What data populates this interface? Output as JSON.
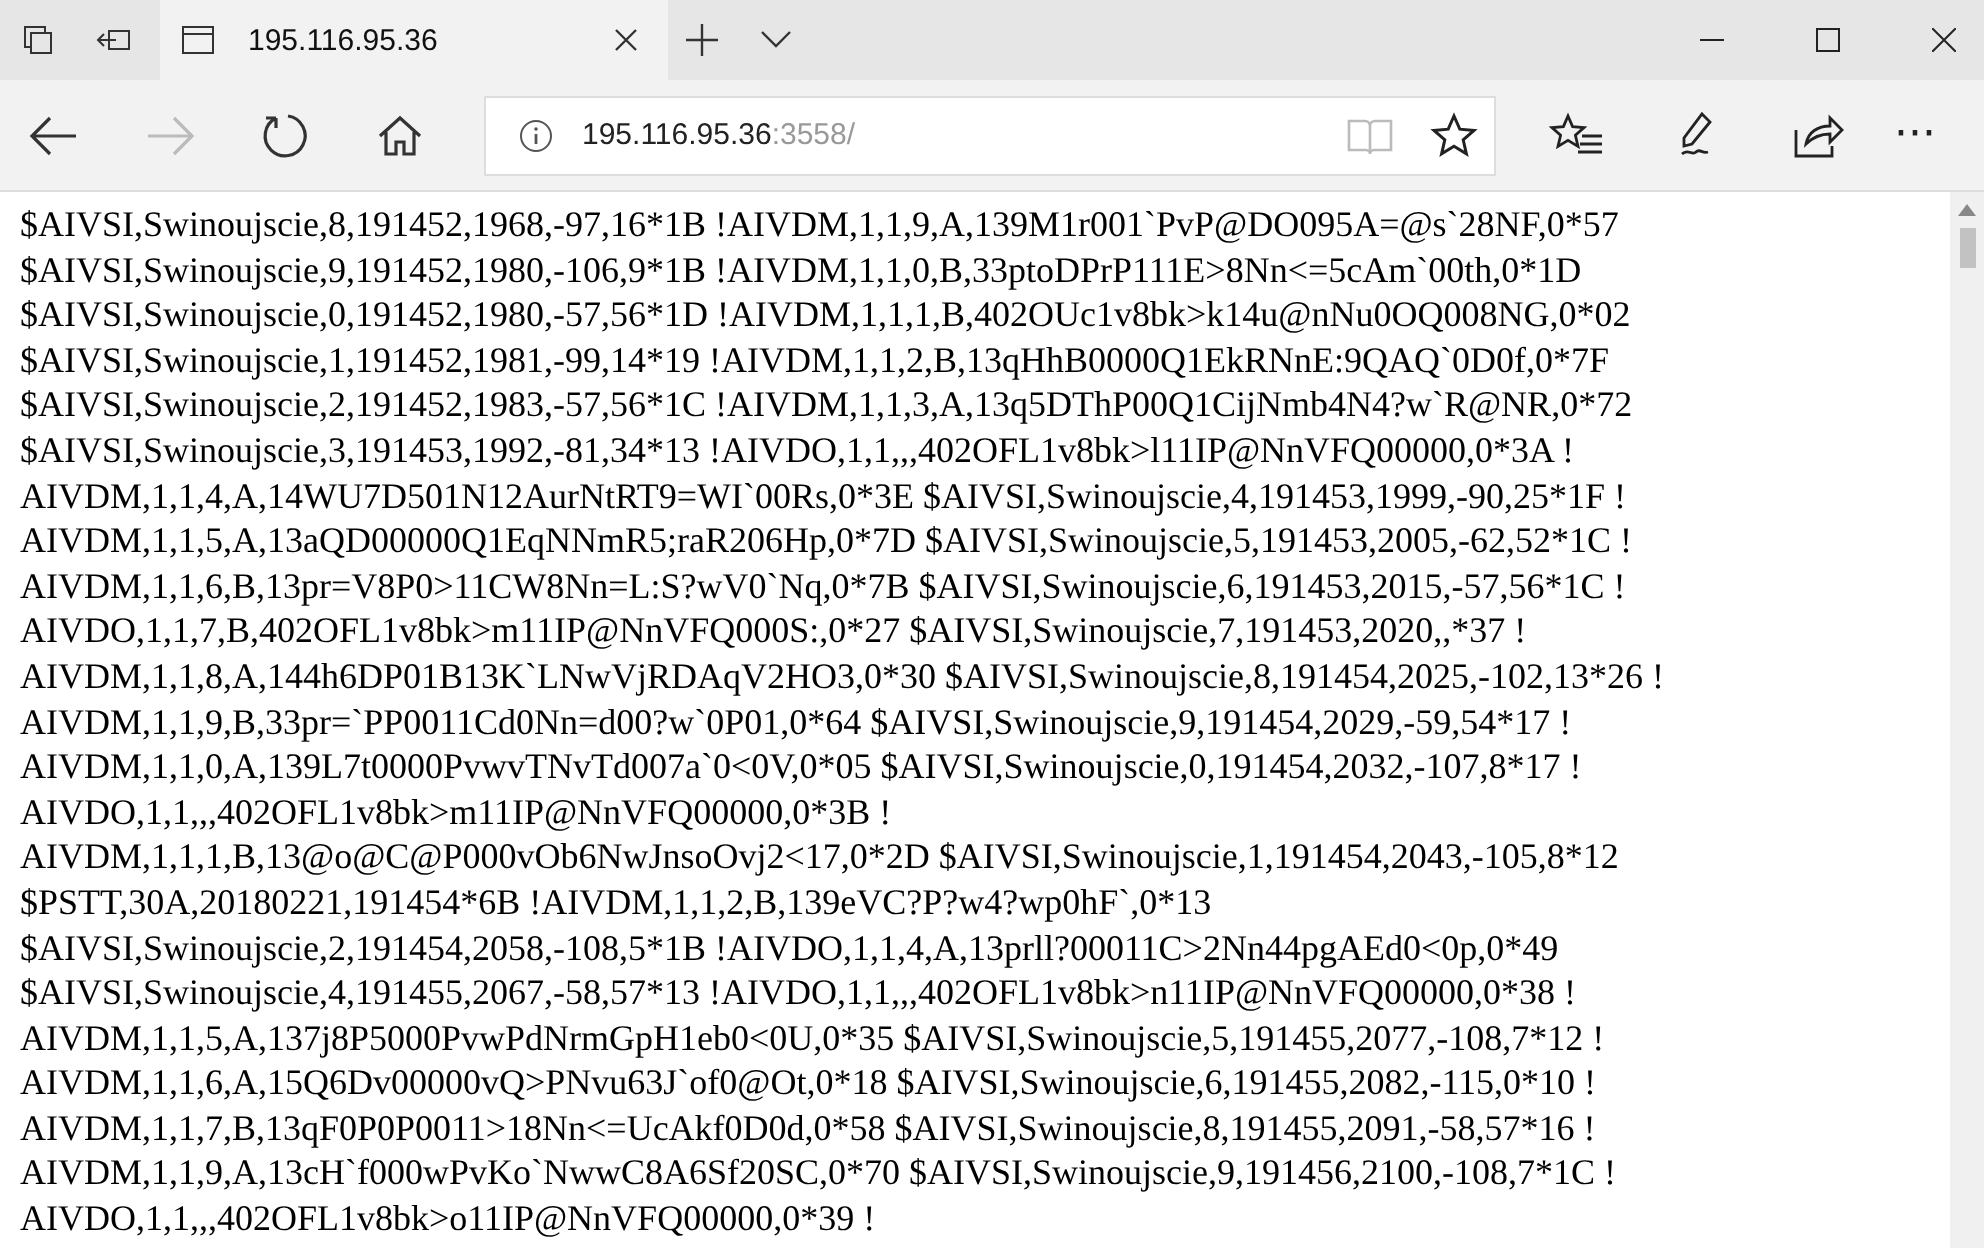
{
  "tab": {
    "title": "195.116.95.36",
    "selected": true
  },
  "address": {
    "host": "195.116.95.36",
    "rest": ":3558/"
  },
  "nav": {
    "back_disabled": false,
    "forward_disabled": true
  },
  "more_label": "···",
  "lines": [
    "$AIVSI,Swinoujscie,8,191452,1968,-97,16*1B !AIVDM,1,1,9,A,139M1r001`PvP@DO095A=@s`28NF,0*57",
    "$AIVSI,Swinoujscie,9,191452,1980,-106,9*1B !AIVDM,1,1,0,B,33ptoDPrP111E>8Nn<=5cAm`00th,0*1D",
    "$AIVSI,Swinoujscie,0,191452,1980,-57,56*1D !AIVDM,1,1,1,B,402OUc1v8bk>k14u@nNu0OQ008NG,0*02",
    "$AIVSI,Swinoujscie,1,191452,1981,-99,14*19 !AIVDM,1,1,2,B,13qHhB0000Q1EkRNnE:9QAQ`0D0f,0*7F",
    "$AIVSI,Swinoujscie,2,191452,1983,-57,56*1C !AIVDM,1,1,3,A,13q5DThP00Q1CijNmb4N4?w`R@NR,0*72",
    "$AIVSI,Swinoujscie,3,191453,1992,-81,34*13 !AIVDO,1,1,,,402OFL1v8bk>l11IP@NnVFQ00000,0*3A !",
    "AIVDM,1,1,4,A,14WU7D501N12AurNtRT9=WI`00Rs,0*3E $AIVSI,Swinoujscie,4,191453,1999,-90,25*1F !",
    "AIVDM,1,1,5,A,13aQD00000Q1EqNNmR5;raR206Hp,0*7D $AIVSI,Swinoujscie,5,191453,2005,-62,52*1C !",
    "AIVDM,1,1,6,B,13pr=V8P0>11CW8Nn=L:S?wV0`Nq,0*7B $AIVSI,Swinoujscie,6,191453,2015,-57,56*1C !",
    "AIVDO,1,1,7,B,402OFL1v8bk>m11IP@NnVFQ000S:,0*27 $AIVSI,Swinoujscie,7,191453,2020,,*37 !",
    "AIVDM,1,1,8,A,144h6DP01B13K`LNwVjRDAqV2HO3,0*30 $AIVSI,Swinoujscie,8,191454,2025,-102,13*26 !",
    "AIVDM,1,1,9,B,33pr=`PP0011Cd0Nn=d00?w`0P01,0*64 $AIVSI,Swinoujscie,9,191454,2029,-59,54*17 !",
    "AIVDM,1,1,0,A,139L7t0000PvwvTNvTd007a`0<0V,0*05 $AIVSI,Swinoujscie,0,191454,2032,-107,8*17 !",
    "AIVDO,1,1,,,402OFL1v8bk>m11IP@NnVFQ00000,0*3B !",
    "AIVDM,1,1,1,B,13@o@C@P000vOb6NwJnsoOvj2<17,0*2D $AIVSI,Swinoujscie,1,191454,2043,-105,8*12",
    "$PSTT,30A,20180221,191454*6B !AIVDM,1,1,2,B,139eVC?P?w4?wp0hF`,0*13",
    "$AIVSI,Swinoujscie,2,191454,2058,-108,5*1B !AIVDO,1,1,4,A,13prll?00011C>2Nn44pgAEd0<0p,0*49",
    "$AIVSI,Swinoujscie,4,191455,2067,-58,57*13 !AIVDO,1,1,,,402OFL1v8bk>n11IP@NnVFQ00000,0*38 !",
    "AIVDM,1,1,5,A,137j8P5000PvwPdNrmGpH1eb0<0U,0*35 $AIVSI,Swinoujscie,5,191455,2077,-108,7*12 !",
    "AIVDM,1,1,6,A,15Q6Dv00000vQ>PNvu63J`of0@Ot,0*18 $AIVSI,Swinoujscie,6,191455,2082,-115,0*10 !",
    "AIVDM,1,1,7,B,13qF0P0P0011>18Nn<=UcAkf0D0d,0*58 $AIVSI,Swinoujscie,8,191455,2091,-58,57*16 !",
    "AIVDM,1,1,9,A,13cH`f000wPvKo`NwwC8A6Sf20SC,0*70 $AIVSI,Swinoujscie,9,191456,2100,-108,7*1C !",
    "AIVDO,1,1,,,402OFL1v8bk>o11IP@NnVFQ00000,0*39 !"
  ]
}
